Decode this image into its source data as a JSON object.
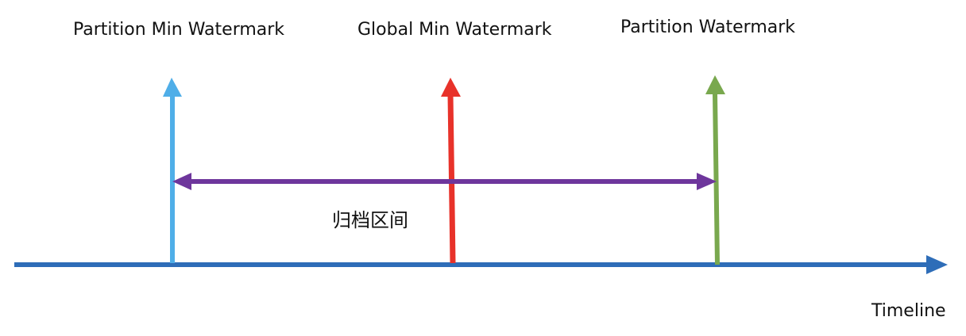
{
  "markers": [
    {
      "label": "Partition Min Watermark",
      "color": "#4FAEE8"
    },
    {
      "label": "Global Min Watermark",
      "color": "#E8322A"
    },
    {
      "label": "Partition Watermark",
      "color": "#79A84E"
    }
  ],
  "range": {
    "label": "归档区间",
    "color": "#6E369C"
  },
  "timeline": {
    "label": "Timeline",
    "color": "#2E6DB8"
  }
}
